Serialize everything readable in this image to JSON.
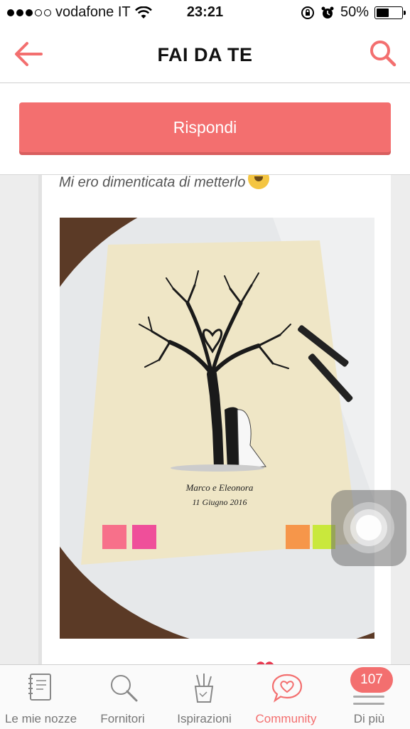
{
  "status_bar": {
    "signal_dots_filled": 3,
    "signal_dots_total": 5,
    "carrier": "vodafone IT",
    "time": "23:21",
    "battery_percent_label": "50%",
    "battery_level": 0.5
  },
  "nav": {
    "title": "FAI DA TE",
    "back_icon": "arrow-left-icon",
    "search_icon": "search-icon"
  },
  "reply_button": {
    "label": "Rispondi"
  },
  "post": {
    "text": "Mi ero dimenticata di metterlo",
    "emoji": "smiling-face-emoji",
    "photo": {
      "names": "Marco e Eleonora",
      "date": "11 Giugno 2016"
    }
  },
  "tabbar": {
    "tabs": [
      {
        "label": "Le mie nozze",
        "icon": "notebook-icon",
        "active": false
      },
      {
        "label": "Fornitori",
        "icon": "search-icon",
        "active": false
      },
      {
        "label": "Ispirazioni",
        "icon": "pencil-cup-icon",
        "active": false
      },
      {
        "label": "Community",
        "icon": "heart-chat-icon",
        "active": true
      },
      {
        "label": "Di più",
        "icon": "menu-icon",
        "active": false
      }
    ],
    "badge": "107"
  },
  "colors": {
    "accent": "#f36f6f",
    "nav_bg": "#ffffff",
    "tab_inactive": "#777777"
  }
}
